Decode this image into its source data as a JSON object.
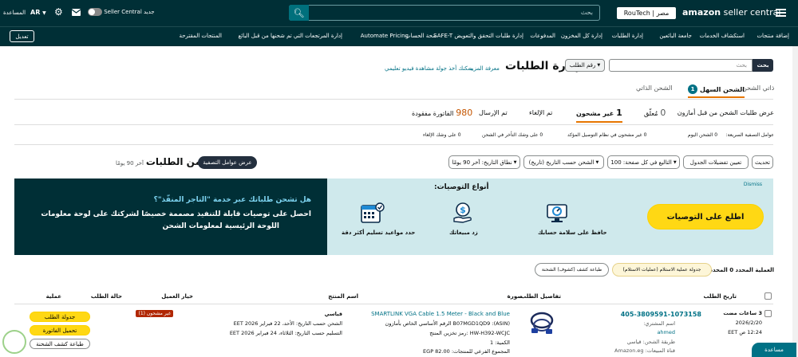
{
  "topbar": {
    "menu_icon": "hamburger-icon",
    "logo_brand": "amazon",
    "logo_product": " seller central",
    "store_selector": "RouTech | مصر",
    "search_placeholder": "بحث",
    "seller_central_toggle": "Seller Central جديد",
    "mail_icon": "mail-icon",
    "settings_icon": "gear-icon",
    "language": "AR",
    "help": "المساعدة"
  },
  "navbar": {
    "items": [
      "إضافة منتجات",
      "استكشاف الخدمات",
      "جامعة البائعين",
      "إدارة الطلبات",
      "إدارة كل المخزون",
      "المدفوعات",
      "إدارة طلبات التحقق والتعويض SAFE-T",
      "صحة الحساب",
      "Automate Pricing",
      "إدارة المرتجعات التي تم شحنها من قبل البائع",
      "المنتجات المقترحة"
    ],
    "edit_button": "تعديل"
  },
  "header": {
    "title": "إدارة الطلبات",
    "learn_more": "معرفة المزيد",
    "video_tour": "يمكنك أخذ جولة مشاهدة فيديو تعليمي",
    "search_type": "رقم الطلب",
    "search_placeholder": "بحث",
    "search_button": "بحث"
  },
  "shipping_tabs": [
    {
      "label": "ذاتي الشحن",
      "active": false
    },
    {
      "badge": "1",
      "label": "الشحن السهل",
      "active": true
    },
    {
      "label": "الشحن الذاتي",
      "active": false
    }
  ],
  "status": {
    "heading": "عرض طلبات الشحن من قبل أمازون",
    "tabs": [
      {
        "count": "0",
        "label": "مُعلّق"
      },
      {
        "count": "1",
        "label": "غير مشحون",
        "active": true
      },
      {
        "count": "",
        "label": "تم الإلغاء"
      },
      {
        "count": "",
        "label": "تم الإرسال"
      },
      {
        "count": "980",
        "label": "الفاتورة مفقودة"
      }
    ]
  },
  "urgency": {
    "label": "عوامل التصفية السريعة:",
    "items": [
      "0 الشحن اليوم",
      "0 غير مشحون في نظام التوصيل المؤكد",
      "0 على وشك التأخر في الشحن",
      "0 على وشك الإلغاء"
    ]
  },
  "filters": {
    "refresh": "تحديث",
    "column_prefs": "تعيين تفضيلات الجدول",
    "page_size": "التاليع في كل صفحة: 100",
    "sort": "الشحن حسب التاريخ (تاريخ)",
    "date_range": "نطاق التاريخ: آخر 90 يومًا"
  },
  "summary": {
    "count_label": "1 من الطلبات",
    "period": "آخر 90 يومًا",
    "filters_button": "عرض عوامل التصفية"
  },
  "banner": {
    "dismiss": "Dismiss",
    "cta": "اطلع على التوصيات",
    "types_title": "أنواع التوصيات:",
    "types": [
      {
        "icon": "dashboard-icon",
        "label": "حافظ على سلامة حسابك"
      },
      {
        "icon": "money-hand-icon",
        "label": "زد مبيعاتك"
      },
      {
        "icon": "calendar-check-icon",
        "label": "حدد مواعيد تسليم أكثر دقة"
      }
    ],
    "promo_title": "هل تشحن طلباتك عبر خدمة \"التاجر المنفّذ\"؟",
    "promo_body": "احصل على توصيات قابلة للتنفيذ مصممة خصيصًا لشركتك على لوحة معلومات",
    "promo_body2": "اللوحة الرئيسية لمعلومات الشحن"
  },
  "bulk": {
    "selected_label": "العملية المحدد 0 المحدد:",
    "action1": "جدولة عملية الاستلام (عمليات الاستلام)",
    "action2": "طباعة كشف (كشوف) الشحنة"
  },
  "table": {
    "headers": [
      "تاريخ الطلب",
      "تفاصيل الطلب",
      "صورة",
      "اسم المنتج",
      "خيار العميل",
      "حالة الطلب",
      "عملية"
    ],
    "row": {
      "age": "3 ساعات مضت",
      "date": "2026/2/20",
      "time": "12:24 ص EET",
      "order_id": "405-3809591-1073158",
      "buyer_label": "اسم المشتري:",
      "buyer": "ahmed",
      "ship_method": "طريقة الشحن: قياسي",
      "channel": "قناة المبيعات: Amazon.eg",
      "product_name": "SMARTLINK VGA Cable 1.5 Meter - Black and Blue",
      "asin": "B07MGD1QD9 :(ASIN) الرقم الأساسي الخاص بأمازون",
      "sku": "HW-H392-WCJC :رمز تخزين المنتج",
      "qty": "الكمية: 1",
      "subtotal": "المجموع الفرعي للمنتجات: EGP 82.00",
      "customer_option_title": "قياسي",
      "ship_by": "الشحن حسب التاريخ: الأحد، 22 فبراير 2026 EET",
      "deliver_by": "التسليم حسب التاريخ: الثلاثاء، 24 فبراير 2026 EET",
      "status": "غير مشحون (1)",
      "btn1": "جدولة الطلب",
      "btn2": "تحميل الفاتورة",
      "btn3": "طباعة كشف الشحنة"
    }
  },
  "chat": {
    "label": "مساعدة"
  },
  "colors": {
    "topbar": "#002f36",
    "teal": "#007185",
    "yellow": "#ffd814",
    "banner_light": "#cfe9ec",
    "active_tab": "#007185",
    "status_red": "#b12704"
  }
}
